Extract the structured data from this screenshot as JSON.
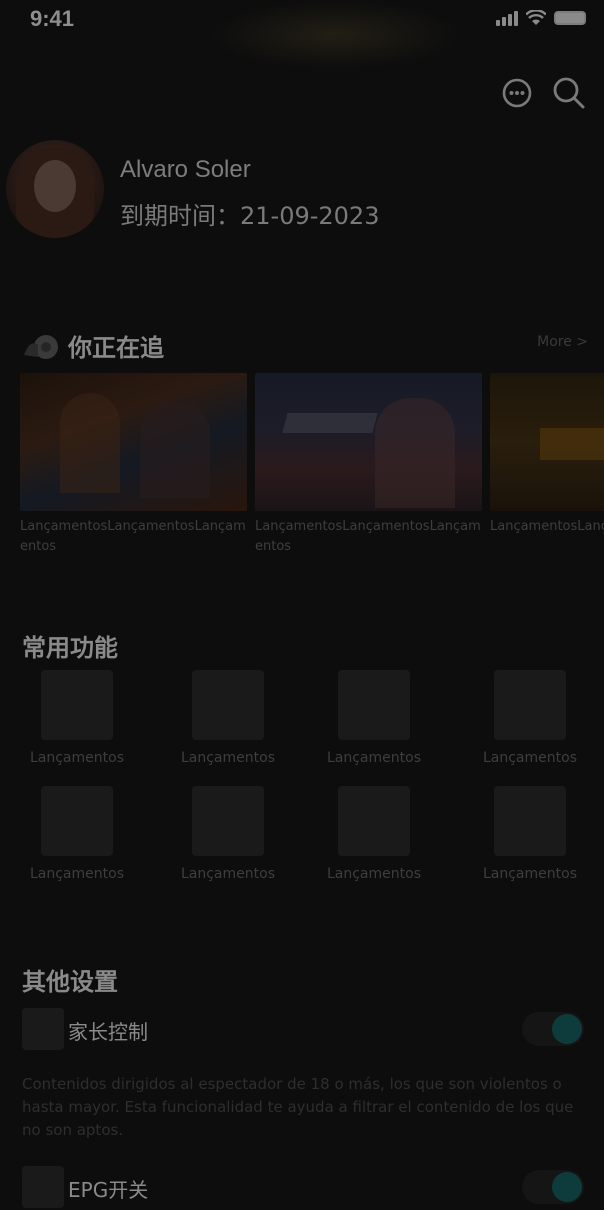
{
  "status_bar": {
    "time": "9:41"
  },
  "top_actions": {
    "message_icon": "chat-bubble-icon",
    "search_icon": "search-icon"
  },
  "profile": {
    "name": "Alvaro Soler",
    "expire": "到期时间：21-09-2023"
  },
  "watching": {
    "title": "你正在追",
    "more": "More >",
    "items": [
      {
        "caption": "LançamentosLançamentosLançamentos"
      },
      {
        "caption": "LançamentosLançamentosLançamentos"
      },
      {
        "caption": "LançamentosLançamentos"
      }
    ]
  },
  "features": {
    "title": "常用功能",
    "items": [
      {
        "label": "Lançamentos"
      },
      {
        "label": "Lançamentos"
      },
      {
        "label": "Lançamentos"
      },
      {
        "label": "Lançamentos"
      },
      {
        "label": "Lançamentos"
      },
      {
        "label": "Lançamentos"
      },
      {
        "label": "Lançamentos"
      },
      {
        "label": "Lançamentos"
      }
    ]
  },
  "settings": {
    "title": "其他设置",
    "items": [
      {
        "title": "家长控制",
        "enabled": true,
        "description": "Contenidos dirigidos al espectador de 18 o más, los que son violentos o hasta mayor. Esta funcionalidad te ayuda a filtrar el contenido de los que no son aptos."
      },
      {
        "title": "EPG开关",
        "enabled": true
      }
    ]
  },
  "colors": {
    "accent": "#0e3b3b",
    "background": "#0d0d0d"
  }
}
